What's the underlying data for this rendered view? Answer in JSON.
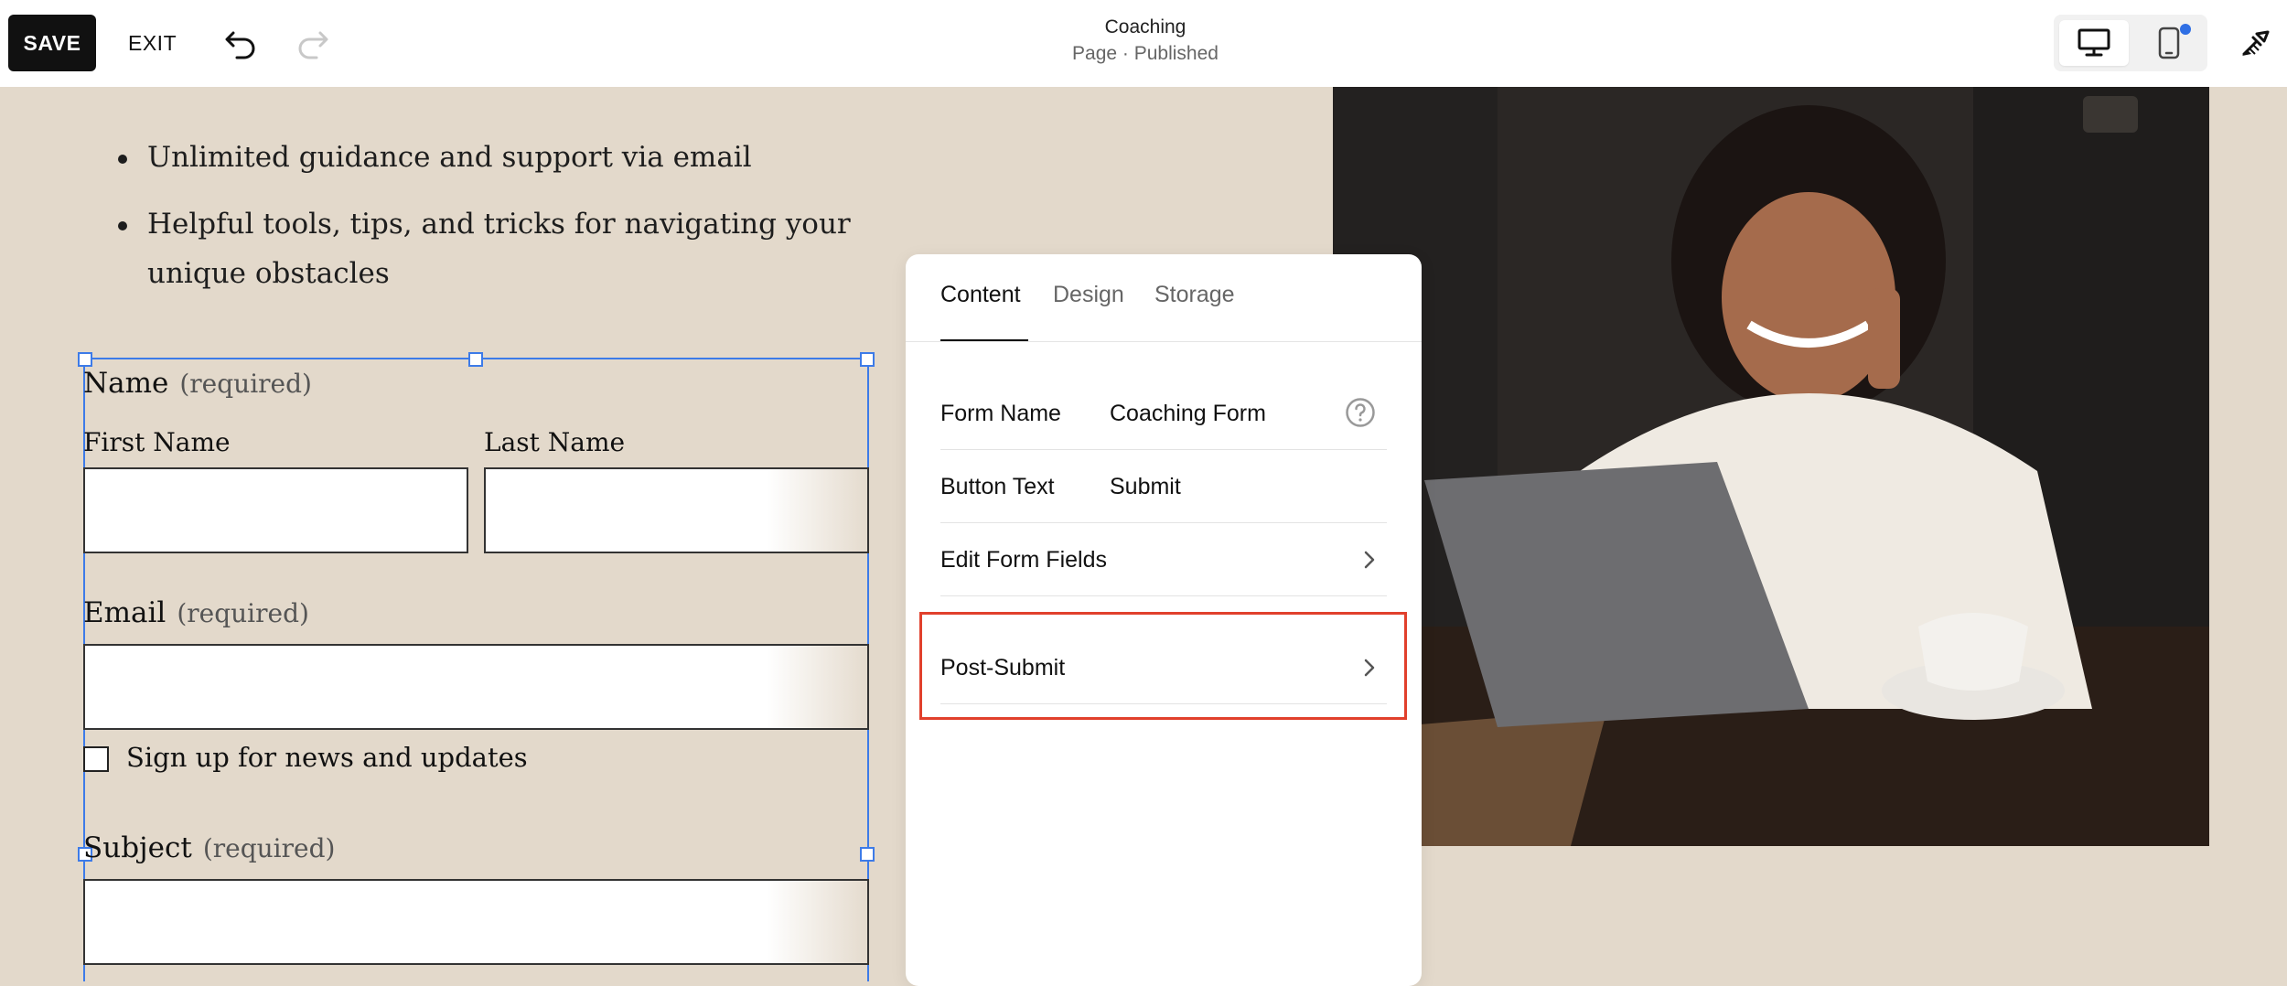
{
  "toolbar": {
    "save_label": "SAVE",
    "exit_label": "EXIT",
    "page_title": "Coaching",
    "page_status": "Page · Published"
  },
  "content": {
    "bullets": [
      "Unlimited guidance and support via email",
      "Helpful tools, tips, and tricks for navigating your unique obstacles"
    ]
  },
  "form": {
    "name_label": "Name",
    "required": "(required)",
    "first_name": "First Name",
    "last_name": "Last Name",
    "email_label": "Email",
    "checkbox_label": "Sign up for news and updates",
    "subject_label": "Subject"
  },
  "panel": {
    "tabs": [
      "Content",
      "Design",
      "Storage"
    ],
    "active_tab": "Content",
    "rows": [
      {
        "label": "Form Name",
        "value": "Coaching Form"
      },
      {
        "label": "Button Text",
        "value": "Submit"
      },
      {
        "label": "Edit Form Fields"
      },
      {
        "label": "Post-Submit"
      }
    ]
  },
  "colors": {
    "background": "#e3d9cb",
    "selection": "#3d7be8",
    "highlight": "#e1402c",
    "notification_dot": "#2f6fe4"
  },
  "icons": [
    "undo-icon",
    "redo-icon",
    "desktop-icon",
    "mobile-icon",
    "design-brush-icon",
    "help-icon",
    "chevron-right-icon"
  ]
}
